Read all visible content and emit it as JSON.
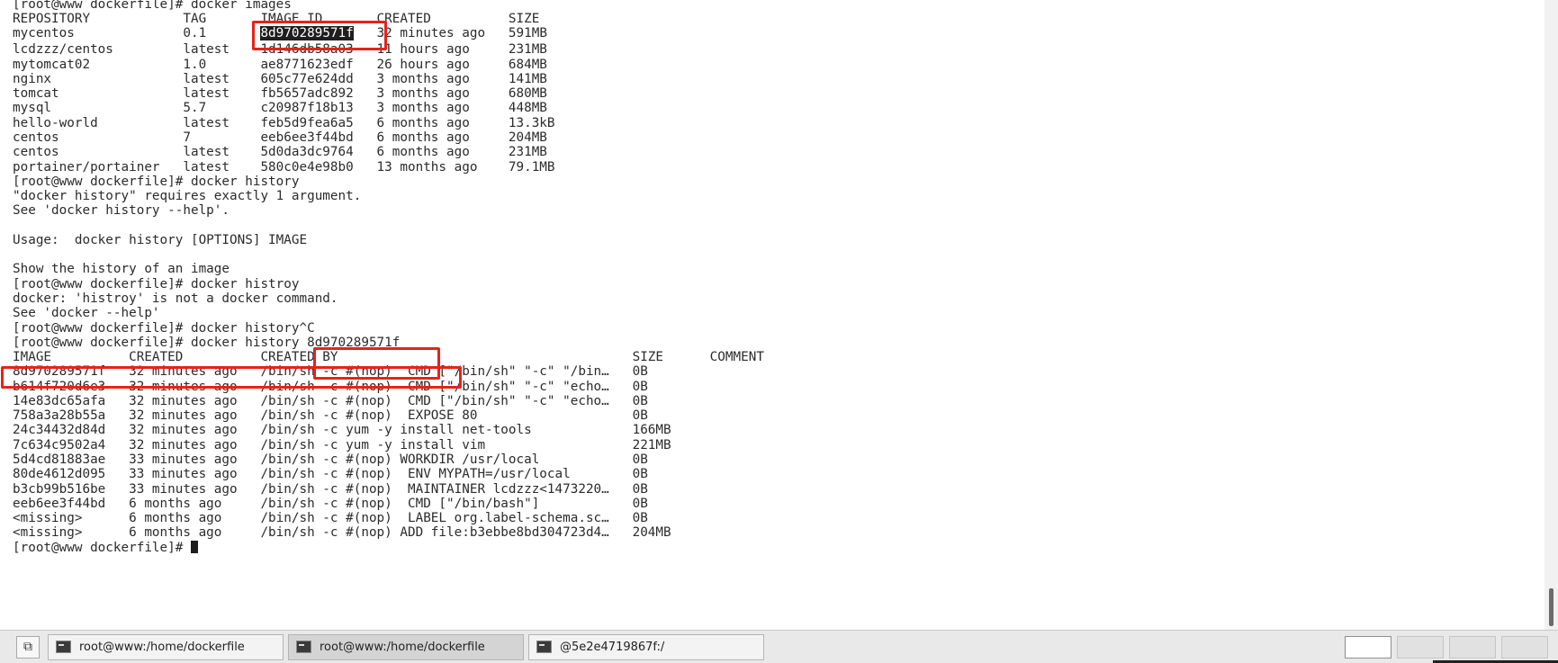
{
  "terminal": {
    "lines": [
      "[root@www dockerfile]# docker images",
      "REPOSITORY            TAG       IMAGE ID       CREATED          SIZE",
      "mycentos              0.1       8d970289571f   32 minutes ago   591MB",
      "lcdzzz/centos         latest    1d146db58a03   11 hours ago     231MB",
      "mytomcat02            1.0       ae8771623edf   26 hours ago     684MB",
      "nginx                 latest    605c77e624dd   3 months ago     141MB",
      "tomcat                latest    fb5657adc892   3 months ago     680MB",
      "mysql                 5.7       c20987f18b13   3 months ago     448MB",
      "hello-world           latest    feb5d9fea6a5   6 months ago     13.3kB",
      "centos                7         eeb6ee3f44bd   6 months ago     204MB",
      "centos                latest    5d0da3dc9764   6 months ago     231MB",
      "portainer/portainer   latest    580c0e4e98b0   13 months ago    79.1MB",
      "[root@www dockerfile]# docker history",
      "\"docker history\" requires exactly 1 argument.",
      "See 'docker history --help'.",
      "",
      "Usage:  docker history [OPTIONS] IMAGE",
      "",
      "Show the history of an image",
      "[root@www dockerfile]# docker histroy",
      "docker: 'histroy' is not a docker command.",
      "See 'docker --help'",
      "[root@www dockerfile]# docker history^C",
      "[root@www dockerfile]# docker history 8d970289571f",
      "IMAGE          CREATED          CREATED BY                                      SIZE      COMMENT",
      "8d970289571f   32 minutes ago   /bin/sh -c #(nop)  CMD [\"/bin/sh\" \"-c\" \"/bin…   0B",
      "b614f720d6e3   32 minutes ago   /bin/sh -c #(nop)  CMD [\"/bin/sh\" \"-c\" \"echo…   0B",
      "14e83dc65afa   32 minutes ago   /bin/sh -c #(nop)  CMD [\"/bin/sh\" \"-c\" \"echo…   0B",
      "758a3a28b55a   32 minutes ago   /bin/sh -c #(nop)  EXPOSE 80                    0B",
      "24c34432d84d   32 minutes ago   /bin/sh -c yum -y install net-tools             166MB",
      "7c634c9502a4   32 minutes ago   /bin/sh -c yum -y install vim                   221MB",
      "5d4cd81883ae   33 minutes ago   /bin/sh -c #(nop) WORKDIR /usr/local            0B",
      "80de4612d095   33 minutes ago   /bin/sh -c #(nop)  ENV MYPATH=/usr/local        0B",
      "b3cb99b516be   33 minutes ago   /bin/sh -c #(nop)  MAINTAINER lcdzzz<1473220…   0B",
      "eeb6ee3f44bd   6 months ago     /bin/sh -c #(nop)  CMD [\"/bin/bash\"]            0B",
      "<missing>      6 months ago     /bin/sh -c #(nop)  LABEL org.label-schema.sc…   0B",
      "<missing>      6 months ago     /bin/sh -c #(nop) ADD file:b3ebbe8bd304723d4…   204MB"
    ],
    "selected_prefix": "mycentos              0.1       ",
    "selected_text": "8d970289571f",
    "selected_suffix": "   32 minutes ago   591MB",
    "prompt": "[root@www dockerfile]# "
  },
  "taskbar": {
    "tasks": [
      {
        "label": "root@www:/home/dockerfile",
        "active": false
      },
      {
        "label": "root@www:/home/dockerfile",
        "active": true
      },
      {
        "label": "@5e2e4719867f:/",
        "active": false
      }
    ]
  },
  "colors": {
    "annotation": "#e5231b",
    "terminal_bg": "#ffffff",
    "text": "#2b2b2b"
  }
}
